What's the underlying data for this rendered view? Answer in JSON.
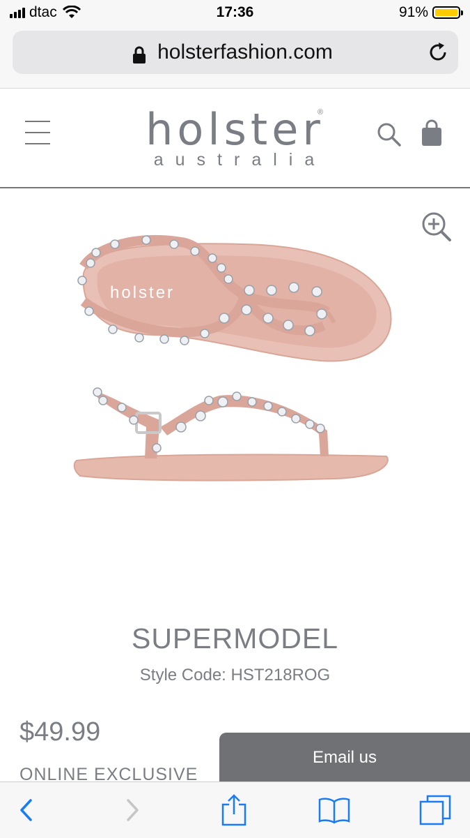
{
  "status_bar": {
    "carrier": "dtac",
    "time": "17:36",
    "battery_percent": "91%",
    "battery_level": 0.91,
    "battery_color": "#ffcc00"
  },
  "browser": {
    "url": "holsterfashion.com"
  },
  "header": {
    "logo_main": "holster",
    "logo_sub": "australia",
    "logo_mark": "®",
    "menu_icon": "hamburger-menu-icon",
    "search_icon": "search-icon",
    "cart_icon": "shopping-bag-icon"
  },
  "product": {
    "zoom_icon": "zoom-in-icon",
    "image_brand": "holster",
    "name": "SUPERMODEL",
    "style_code": "Style Code: HST218ROG",
    "price": "$49.99",
    "badge": "ONLINE EXCLUSIVE"
  },
  "contact": {
    "email_label": "Email us"
  },
  "toolbar": {
    "back_icon": "back-chevron-icon",
    "forward_icon": "forward-chevron-icon",
    "share_icon": "share-icon",
    "bookmarks_icon": "bookmarks-icon",
    "tabs_icon": "tabs-icon",
    "accent": "#1a7cf5"
  },
  "colors": {
    "brand_gray": "#7a7e84",
    "sandal_pink": "#e3b2a6"
  }
}
